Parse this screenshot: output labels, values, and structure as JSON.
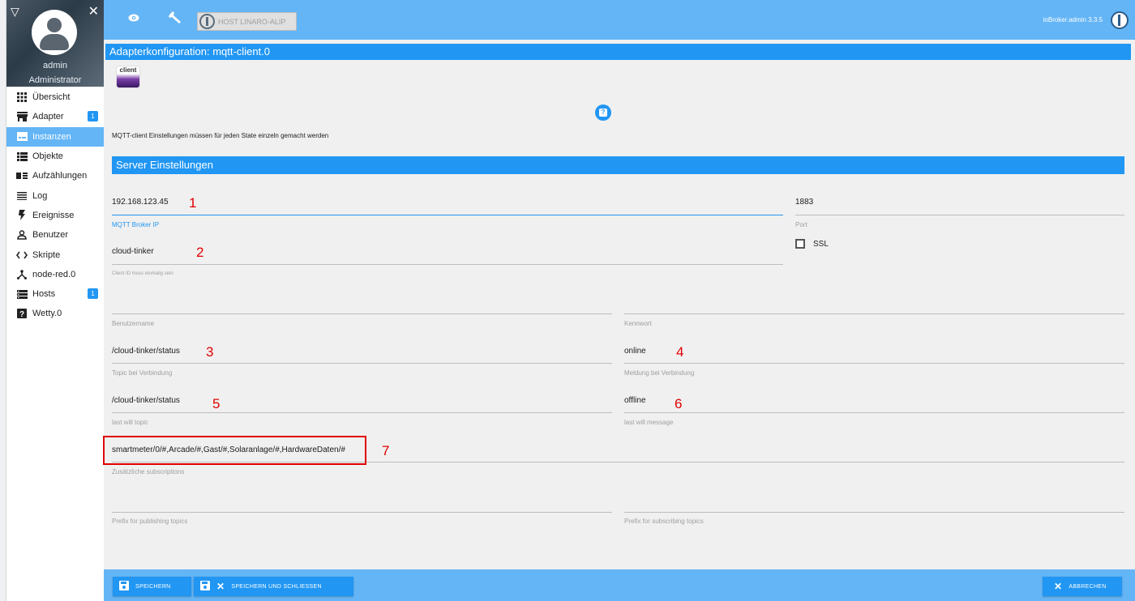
{
  "sidebar": {
    "user": {
      "name": "admin",
      "role": "Administrator"
    },
    "items": [
      {
        "label": "Übersicht",
        "icon": "grid-icon",
        "badge": ""
      },
      {
        "label": "Adapter",
        "icon": "store-icon",
        "badge": "1"
      },
      {
        "label": "Instanzen",
        "icon": "instances-icon",
        "badge": "",
        "active": true
      },
      {
        "label": "Objekte",
        "icon": "list-icon",
        "badge": ""
      },
      {
        "label": "Aufzählungen",
        "icon": "enum-icon",
        "badge": ""
      },
      {
        "label": "Log",
        "icon": "log-icon",
        "badge": ""
      },
      {
        "label": "Ereignisse",
        "icon": "flash-icon",
        "badge": ""
      },
      {
        "label": "Benutzer",
        "icon": "user-icon",
        "badge": ""
      },
      {
        "label": "Skripte",
        "icon": "code-icon",
        "badge": ""
      },
      {
        "label": "node-red.0",
        "icon": "node-red-icon",
        "badge": ""
      },
      {
        "label": "Hosts",
        "icon": "hosts-icon",
        "badge": "1"
      },
      {
        "label": "Wetty.0",
        "icon": "help-box-icon",
        "badge": ""
      }
    ]
  },
  "topbar": {
    "host_label": "HOST LINARO-ALIP",
    "version": "ioBroker.admin 3.3.5"
  },
  "content": {
    "title": "Adapterkonfiguration: mqtt-client.0",
    "logo_text": "client",
    "help_label": "?",
    "note": "MQTT-client Einstellungen müssen für jeden State einzeln gemacht werden",
    "section_title": "Server Einstellungen",
    "fields": {
      "broker_ip": {
        "value": "192.168.123.45",
        "label": "MQTT Broker IP"
      },
      "port": {
        "value": "1883",
        "label": "Port"
      },
      "ssl": {
        "label": "SSL",
        "checked": false
      },
      "client_id": {
        "value": "cloud-tinker",
        "label": "Client ID muss einmalig sein"
      },
      "username": {
        "value": "",
        "label": "Benutzername"
      },
      "password": {
        "value": "",
        "label": "Kennwort"
      },
      "topic_connect": {
        "value": "/cloud-tinker/status",
        "label": "Topic bei Verbindung"
      },
      "message_connect": {
        "value": "online",
        "label": "Meldung bei Verbindung"
      },
      "lastwill_topic": {
        "value": "/cloud-tinker/status",
        "label": "last will topic"
      },
      "lastwill_message": {
        "value": "offline",
        "label": "last will message"
      },
      "subscriptions": {
        "value": "smartmeter/0/#,Arcade/#,Gast/#,Solaranlage/#,HardwareDaten/#",
        "label": "Zusätzliche subscriptions"
      },
      "prefix_publish": {
        "value": "",
        "label": "Prefix for publishing topics"
      },
      "prefix_subscribe": {
        "value": "",
        "label": "Prefix for subscribing topics"
      }
    },
    "annotations": [
      "1",
      "2",
      "3",
      "4",
      "5",
      "6",
      "7"
    ]
  },
  "bottombar": {
    "save": "SPEICHERN",
    "save_close": "SPEICHERN UND SCHLIESSEN",
    "cancel": "ABBRECHEN"
  },
  "colors": {
    "accent": "#2196f3",
    "bar": "#64b5f6",
    "annotation": "#e00000"
  }
}
